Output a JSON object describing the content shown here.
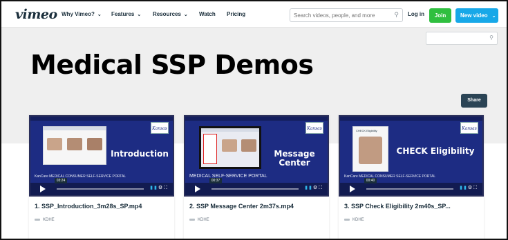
{
  "nav": {
    "logo": "vimeo",
    "items": [
      {
        "label": "Why Vimeo?",
        "dropdown": true
      },
      {
        "label": "Features",
        "dropdown": true
      },
      {
        "label": "Resources",
        "dropdown": true
      },
      {
        "label": "Watch",
        "dropdown": false
      },
      {
        "label": "Pricing",
        "dropdown": false
      }
    ],
    "search_placeholder": "Search videos, people, and more",
    "login_label": "Log in",
    "join_label": "Join",
    "new_video_label": "New video"
  },
  "colors": {
    "join": "#2fbf3f",
    "new_video": "#17a8e8",
    "share": "#2b4455",
    "thumb_bg": "#1d2c83"
  },
  "hero": {
    "title": "Medical SSP Demos",
    "share_label": "Share"
  },
  "videos": [
    {
      "title": "1. SSP_Introduction_3m28s_SP.mp4",
      "owner": "KDHE",
      "thumb_heading": "Introduction",
      "thumb_portal": "KanCare MEDICAL CONSUMER SELF-SERVICE PORTAL",
      "timestamp": "03:24",
      "logo_text": "Kansas"
    },
    {
      "title": "2. SSP Message Center 2m37s.mp4",
      "owner": "KDHE",
      "thumb_heading": "Message Center",
      "thumb_portal": "MEDICAL SELF-SERVICE PORTAL",
      "timestamp": "00:37",
      "logo_text": "Kansas"
    },
    {
      "title": "3. SSP Check Eligibility 2m40s_SP...",
      "owner": "KDHE",
      "thumb_heading": "CHECK Eligibility",
      "thumb_slide_heading": "CHECK Eligibility",
      "thumb_portal": "KanCare MEDICAL CONSUMER SELF-SERVICE PORTAL",
      "timestamp": "00:40",
      "logo_text": "Kansas"
    }
  ]
}
